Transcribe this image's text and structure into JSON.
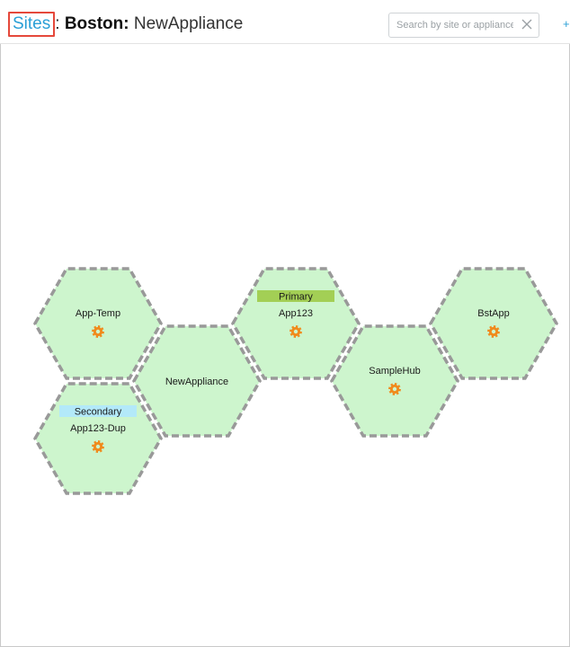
{
  "breadcrumb": {
    "root": "Sites",
    "separator": ":",
    "site": "Boston:",
    "appliance": "NewAppliance"
  },
  "search": {
    "placeholder": "Search by site or appliance",
    "value": ""
  },
  "icons": {
    "clear": "close-icon",
    "add": "plus-icon",
    "settings": "gear-icon"
  },
  "colors": {
    "link": "#2a9fd6",
    "hex_fill": "#cdf5cd",
    "hex_border": "#999999",
    "primary_badge": "#a3cf55",
    "secondary_badge": "#b3e9f9",
    "gear": "#f08a1c",
    "highlight_box": "#e5483b"
  },
  "appliances": [
    {
      "name": "App-Temp",
      "role": "",
      "settings": true
    },
    {
      "name": "NewAppliance",
      "role": "",
      "settings": false
    },
    {
      "name": "App123-Dup",
      "role": "Secondary",
      "settings": true
    },
    {
      "name": "App123",
      "role": "Primary",
      "settings": true
    },
    {
      "name": "SampleHub",
      "role": "",
      "settings": true
    },
    {
      "name": "BstApp",
      "role": "",
      "settings": true
    }
  ]
}
